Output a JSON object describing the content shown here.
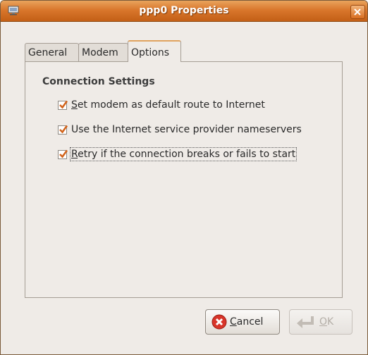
{
  "window": {
    "title": "ppp0 Properties",
    "accent_color": "#d9772c"
  },
  "tabs": [
    {
      "label": "General",
      "active": false
    },
    {
      "label": "Modem",
      "active": false
    },
    {
      "label": "Options",
      "active": true
    }
  ],
  "options": {
    "section_title": "Connection Settings",
    "checkboxes": [
      {
        "mnemonic": "S",
        "rest": "et modem as default route to Internet",
        "checked": true
      },
      {
        "mnemonic": "",
        "rest": "Use the Internet service provider nameservers",
        "checked": true
      },
      {
        "mnemonic": "R",
        "rest": "etry if the connection breaks or fails to start",
        "checked": true
      }
    ]
  },
  "buttons": {
    "cancel": {
      "mnemonic": "C",
      "rest": "ancel",
      "icon": "cancel-icon"
    },
    "ok": {
      "mnemonic": "O",
      "rest": "K",
      "icon": "ok-return-icon",
      "enabled": false
    }
  }
}
